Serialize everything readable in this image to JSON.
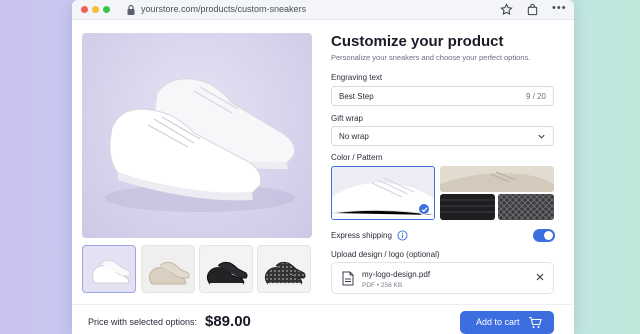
{
  "browser": {
    "url": "yourstore.com/products/custom-sneakers"
  },
  "product": {
    "title": "Customize your product",
    "subtitle": "Personalize your sneakers and choose your perfect options."
  },
  "engraving": {
    "label": "Engraving text",
    "value": "Best Step",
    "count": "9 / 20"
  },
  "gift_wrap": {
    "label": "Gift wrap",
    "value": "No wrap"
  },
  "color": {
    "label": "Color / Pattern",
    "selected": "white"
  },
  "express": {
    "label": "Express shipping",
    "enabled": true
  },
  "upload": {
    "label": "Upload design / logo (optional)",
    "file_name": "my-logo-design.pdf",
    "file_meta": "PDF • 256 KB"
  },
  "footer": {
    "price_label": "Price with selected options:",
    "price": "$89.00",
    "cart_label": "Add to cart"
  },
  "colors": {
    "accent": "#3d6ee0",
    "toggle_on": "#3c6fe0"
  }
}
